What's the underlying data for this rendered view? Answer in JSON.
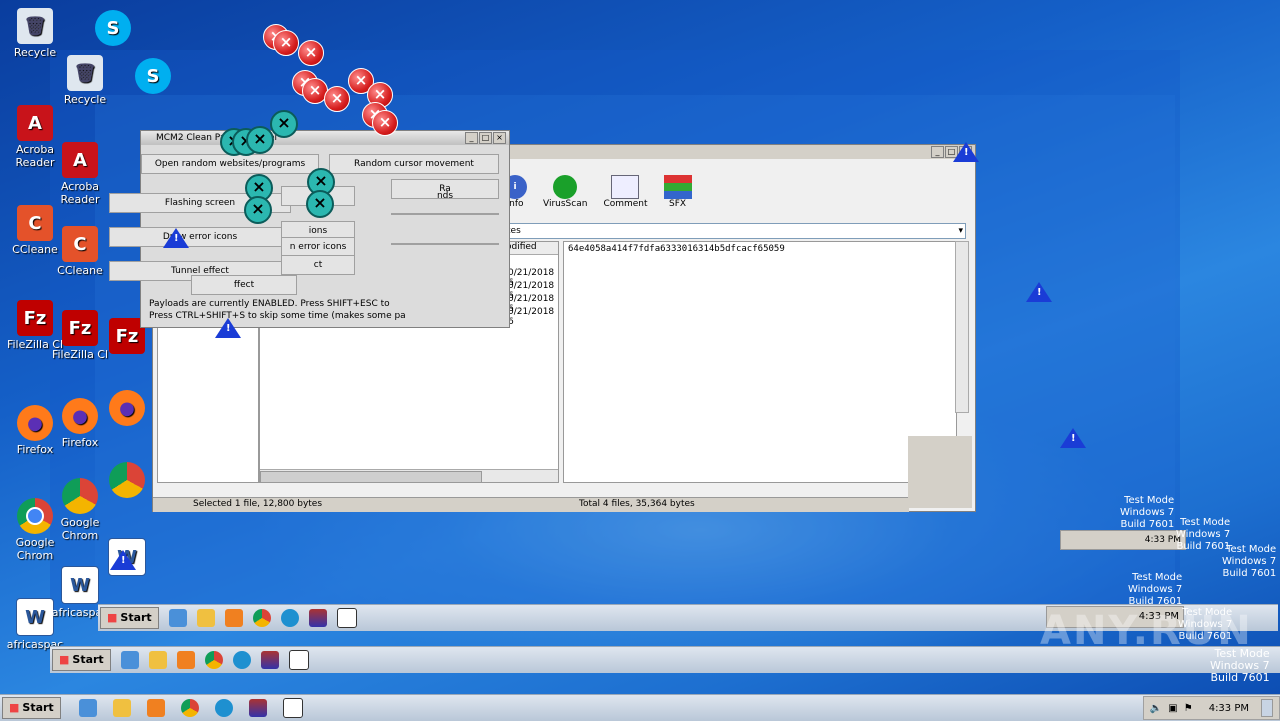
{
  "desktop_icons": [
    {
      "label": "Recycle",
      "icon": "recycle-bin-icon"
    },
    {
      "label": "Acroba Reader",
      "icon": "acrobat-icon"
    },
    {
      "label": "CCleane",
      "icon": "ccleaner-icon"
    },
    {
      "label": "FileZilla Cl",
      "icon": "filezilla-icon"
    },
    {
      "label": "Firefox",
      "icon": "firefox-icon"
    },
    {
      "label": "Google Chrom",
      "icon": "chrome-icon"
    },
    {
      "label": "africaspac",
      "icon": "word-icon"
    },
    {
      "label": "Skype",
      "icon": "skype-icon"
    }
  ],
  "ghost_icons": {
    "recycle": "Recycle",
    "acrobat": "Acroba Reader",
    "ccleaner": "CCleane",
    "filezilla": "FileZilla Cl",
    "firefox": "Firefox",
    "chrome": "Google Chrom",
    "word": "africaspac"
  },
  "mcm2": {
    "title": "MCM2 Clean Payload Panel",
    "buttons": [
      "Open random websites/programs",
      "Random cursor movement",
      "Flashing screen",
      "Draw error icons",
      "Tunnel effect"
    ],
    "partial_buttons": [
      "Ra",
      "nds",
      "een",
      "ions",
      "n error icons",
      "ct",
      "ffect"
    ],
    "status_line1": "Payloads are currently ENABLED. Press SHIFT+ESC to",
    "status_line2": "Press CTRL+SHIFT+S to skip some time (makes some pa"
  },
  "archiver": {
    "toolbar": [
      "Info",
      "VirusScan",
      "Comment",
      "SFX"
    ],
    "path": "tes",
    "col_modified": "odified",
    "dates": [
      "0/21/2018 6",
      "0/21/2018 6",
      "0/21/2018 6",
      "0/21/2018 6"
    ],
    "hash": "64e4058a414f7fdfa6333016314b5dfcacf65059",
    "status_left": "Selected 1 file, 12,800 bytes",
    "status_right": "Total 4 files, 35,364 bytes"
  },
  "taskbar": {
    "start": "Start",
    "time": "4:33 PM"
  },
  "watermark": {
    "test_mode": "Test Mode",
    "windows": "Windows 7",
    "build": "Build 7601",
    "brand": "ANY.RUN"
  },
  "colors": {
    "desktop": "#1560c8",
    "error": "#d61f1f",
    "teal": "#2bb7b0",
    "warn": "#1a3cd6"
  }
}
